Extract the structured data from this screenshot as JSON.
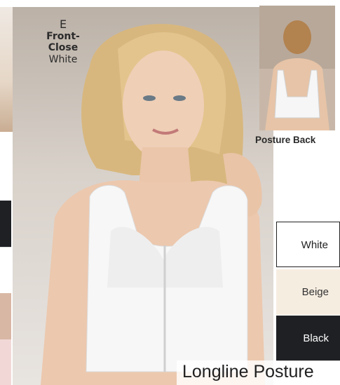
{
  "style": {
    "letter": "E",
    "name": "Front-Close",
    "color": "White"
  },
  "thumbnail": {
    "caption": "Posture Back"
  },
  "swatches": [
    {
      "label": "White",
      "color": "#ffffff"
    },
    {
      "label": "Beige",
      "color": "#f6ede1"
    },
    {
      "label": "Black",
      "color": "#1f2024"
    }
  ],
  "product": {
    "title": "Longline Posture"
  },
  "colors": {
    "text_dark": "#2b2b2b",
    "swatch_black": "#1f2024",
    "swatch_beige": "#f6ede1"
  }
}
